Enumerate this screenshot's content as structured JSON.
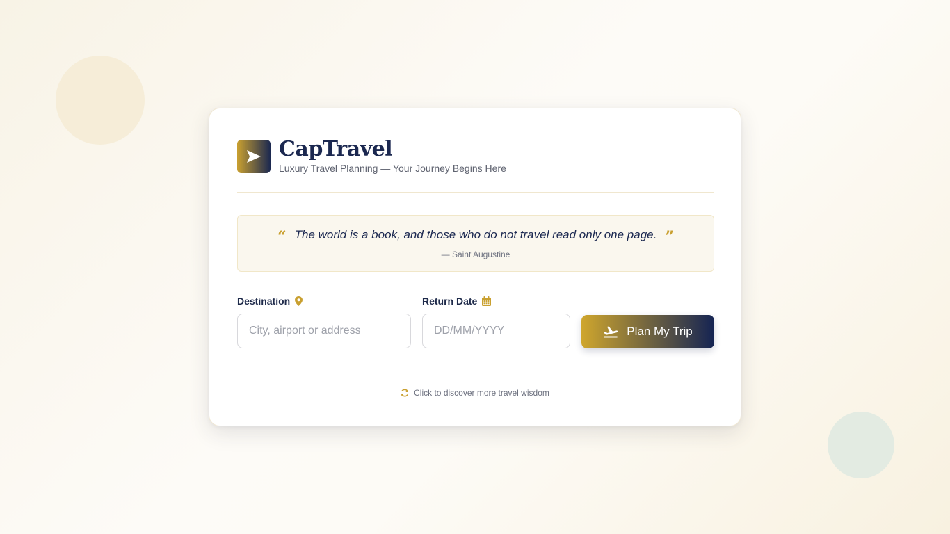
{
  "brand": {
    "name": "CapTravel",
    "tagline": "Luxury Travel Planning — Your Journey Begins Here",
    "logo_icon": "send-arrow-icon"
  },
  "quote": {
    "text": "The world is a book, and those who do not travel read only one page.",
    "author": "— Saint Augustine"
  },
  "form": {
    "destination": {
      "label": "Destination",
      "placeholder": "City, airport or address",
      "value": "",
      "icon": "map-pin-icon"
    },
    "return_date": {
      "label": "Return Date",
      "placeholder": "DD/MM/YYYY",
      "value": "",
      "icon": "calendar-icon"
    },
    "submit_label": "Plan My Trip",
    "submit_icon": "plane-departure-icon"
  },
  "footer": {
    "wisdom_link": "Click to discover more travel wisdom",
    "icon": "refresh-icon"
  },
  "colors": {
    "navy": "#1b2850",
    "gold": "#c9a030",
    "card_bg": "#ffffff",
    "quote_bg": "#faf7ee"
  }
}
